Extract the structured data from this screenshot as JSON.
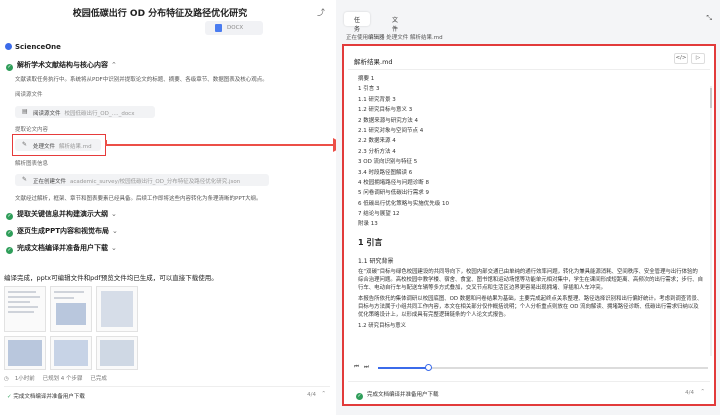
{
  "left": {
    "title": "校园低碳出行 OD 分布特征及路径优化研究",
    "docx_label": "DOCX",
    "brand": "ScienceOne",
    "step1": {
      "heading": "解析学术文献结构与核心内容",
      "desc": "文献读取任务执行中。系统将从PDF中识别并提取论文的标题、摘要、各级章节、数据图表及核心观点。",
      "read_label": "阅读源文件",
      "read_chip": "阅读源文件",
      "read_chip_muted": "校园低碳出行_OD_...._docx",
      "extract_label": "提取论文内容",
      "process_chip": "处理文件",
      "process_chip_muted": "解析结果.md",
      "parse_label": "解析图表信息",
      "create_chip": "正在创建文件",
      "create_chip_muted": "academic_survey/校园低碳出行_OD_分布特征及路径优化研究.json",
      "summary": "文献经过解析，框架、章节和图表要素已经具备。后续工作即将这些内容转化为条理清晰的PPT大纲。"
    },
    "step2": "提取关键信息并构建演示大纲",
    "step3": "逐页生成PPT内容和视觉布局",
    "step4": "完成文档编译并准备用户下载",
    "done_msg": "编译完成，pptx可编辑文件和pdf预览文件均已生成，可以直接下载使用。",
    "status": [
      "1小时前",
      "已规划 4 个步骤",
      "已完成"
    ],
    "bottom": "完成文档编译并准备用户下载",
    "bottom_page": "4/4"
  },
  "right": {
    "tabs": [
      "任务",
      "文件"
    ],
    "status_prefix": "正在使用",
    "status_tool": "编辑器",
    "status_action": "处理文件",
    "status_file": "解析结果.md",
    "editor_title": "解析结果.md",
    "toc": [
      "摘要 1",
      "1 引言 3",
      "1.1 研究背景 3",
      "1.2 研究目标与意义 3",
      "2 数据来源与研究方法 4",
      "2.1 研究对象与空间节点 4",
      "2.2 数据来源 4",
      "2.3 分析方法 4",
      "3 OD 流向识别与特征 5",
      "3.4 时段路径图解读 6",
      "4 校园拥堵路径与问题诊断 8",
      "5 问卷调研与低碳出行需求 9",
      "6 低碳出行优化策略与实施优先级 10",
      "7 结论与展望 12",
      "附录 13"
    ],
    "h1": "1 引言",
    "h2": "1.1 研究背景",
    "para1": "在“双碳”目标与绿色校园建设的共同导向下，校园内部交通已由单纯的通行效率问题，转化为兼具能源消耗、空间秩序、安全管理与出行体验的综合治理问题。高校校园中教学楼、宿舍、食堂、图书馆和运动场馆等功能单元相对集中，学生在课间形成短距离、高频次的出行需求；步行、自行车、电动自行车与配送车辆等多方式叠加，交叉节点和生活区边界更容易出现拥堵、穿插和人车冲突。",
    "para2": "本报告所依托的集体调研以校园底图、OD 数据和问卷结果为基础，主要完成起终点关系整理、路径选择识别和出行偏好统计。考虑到调查背景、目标与方法属于小组共同工作内容，本文在相关部分仅作概括说明；个人分析重点则放在 OD 流向解读、拥堵路径诊断、低碳出行需求归纳以及优化策略设计上，以形成具有完整逻辑链条的个人论文式报告。",
    "para3": "1.2 研究目标与意义",
    "footer": "完成文档编译并准备用户下载",
    "footer_page": "4/4"
  }
}
